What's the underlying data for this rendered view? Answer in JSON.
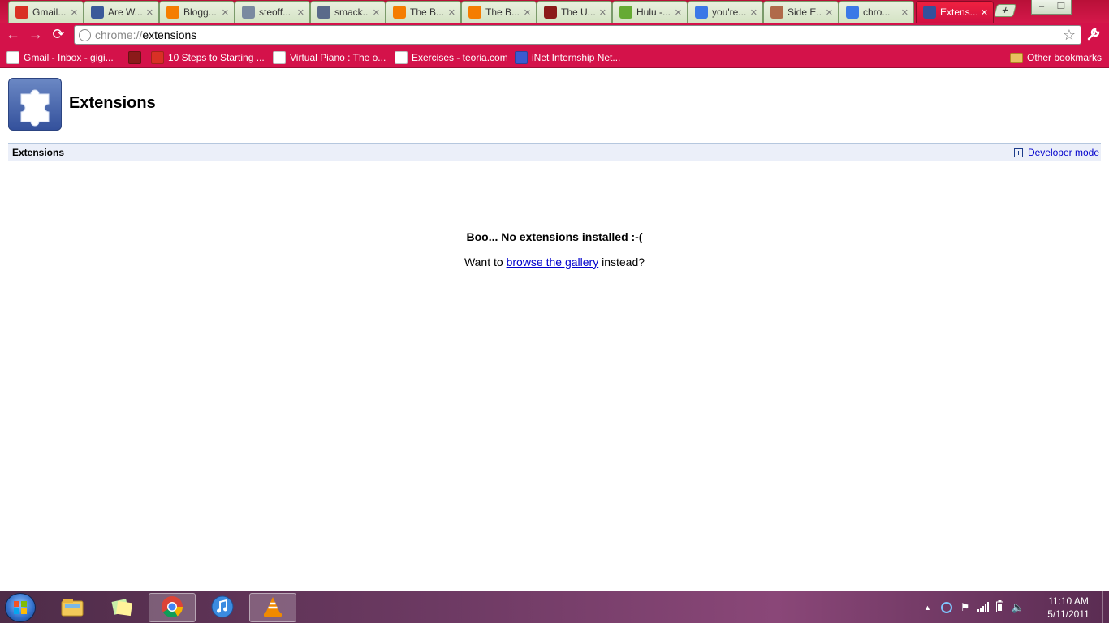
{
  "browser": {
    "tabs": [
      {
        "title": "Gmail...",
        "icon": "gmail-icon",
        "color": "#d93025"
      },
      {
        "title": "Are W...",
        "icon": "page-icon",
        "color": "#3a5a9a"
      },
      {
        "title": "Blogg...",
        "icon": "blogger-icon",
        "color": "#f57d00"
      },
      {
        "title": "steoff...",
        "icon": "page-icon",
        "color": "#7a8aa0"
      },
      {
        "title": "smack...",
        "icon": "page-icon",
        "color": "#5a6a8a"
      },
      {
        "title": "The B...",
        "icon": "blogger-icon",
        "color": "#f57d00"
      },
      {
        "title": "The B...",
        "icon": "blogger-icon",
        "color": "#f57d00"
      },
      {
        "title": "The U...",
        "icon": "tusb-icon",
        "color": "#8b1a1a"
      },
      {
        "title": "Hulu -...",
        "icon": "hulu-icon",
        "color": "#66aa33"
      },
      {
        "title": "you're...",
        "icon": "google-icon",
        "color": "#3b78e7"
      },
      {
        "title": "Side E...",
        "icon": "page-icon",
        "color": "#b06a4a"
      },
      {
        "title": "chro...",
        "icon": "google-icon",
        "color": "#3b78e7"
      },
      {
        "title": "Extens...",
        "icon": "puzzle-icon",
        "color": "#34519c",
        "active": true
      }
    ],
    "url_scheme": "chrome://",
    "url_path": "extensions",
    "bookmarks": [
      {
        "label": "Gmail - Inbox - gigi...",
        "icon": "gmail-icon",
        "color": "#ffffff"
      },
      {
        "label": "",
        "icon": "tusb-icon",
        "color": "#8b1a1a"
      },
      {
        "label": "10 Steps to Starting ...",
        "icon": "g-icon",
        "color": "#d93025"
      },
      {
        "label": "Virtual Piano : The o...",
        "icon": "piano-p-icon",
        "color": "#ffffff"
      },
      {
        "label": "Exercises - teoria.com",
        "icon": "piano-keys-icon",
        "color": "#ffffff"
      },
      {
        "label": "iNet Internship Net...",
        "icon": "inet-icon",
        "color": "#3a5ad0"
      }
    ],
    "other_bookmarks": "Other bookmarks"
  },
  "page": {
    "heading": "Extensions",
    "section_title": "Extensions",
    "developer_mode": "Developer mode",
    "empty_title": "Boo... No extensions installed :-(",
    "empty_prefix": "Want to ",
    "empty_link": "browse the gallery",
    "empty_suffix": " instead?"
  },
  "taskbar": {
    "time": "11:10 AM",
    "date": "5/11/2011",
    "apps": [
      {
        "name": "explorer-icon"
      },
      {
        "name": "sticky-notes-icon"
      },
      {
        "name": "chrome-icon",
        "active": true
      },
      {
        "name": "itunes-icon"
      },
      {
        "name": "vlc-icon",
        "active": true
      }
    ]
  }
}
